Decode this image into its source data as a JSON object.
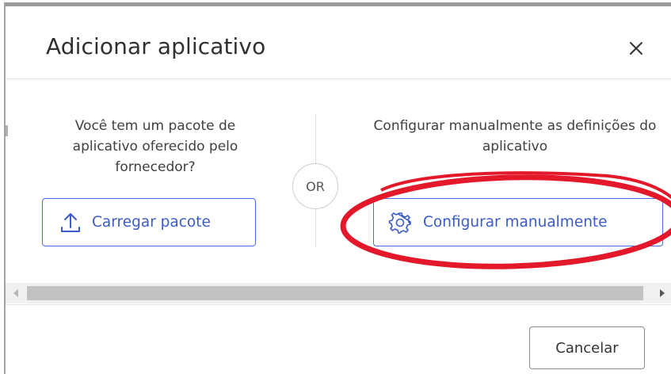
{
  "dialog": {
    "title": "Adicionar aplicativo",
    "close_icon": "close-icon"
  },
  "left_option": {
    "description": "Você tem um pacote de aplicativo oferecido pelo fornecedor?",
    "button_label": "Carregar pacote",
    "button_icon": "upload-icon"
  },
  "separator": {
    "label": "OR"
  },
  "right_option": {
    "description": "Configurar manualmente as definições do aplicativo",
    "button_label": "Configurar manualmente",
    "button_icon": "gear-icon"
  },
  "footer": {
    "cancel_label": "Cancelar"
  },
  "colors": {
    "accent": "#3b5bc8",
    "button_border": "#4a6fe0",
    "annotation": "#e3182a",
    "text": "#404040",
    "scrollbar_thumb": "#c2c2c2"
  }
}
